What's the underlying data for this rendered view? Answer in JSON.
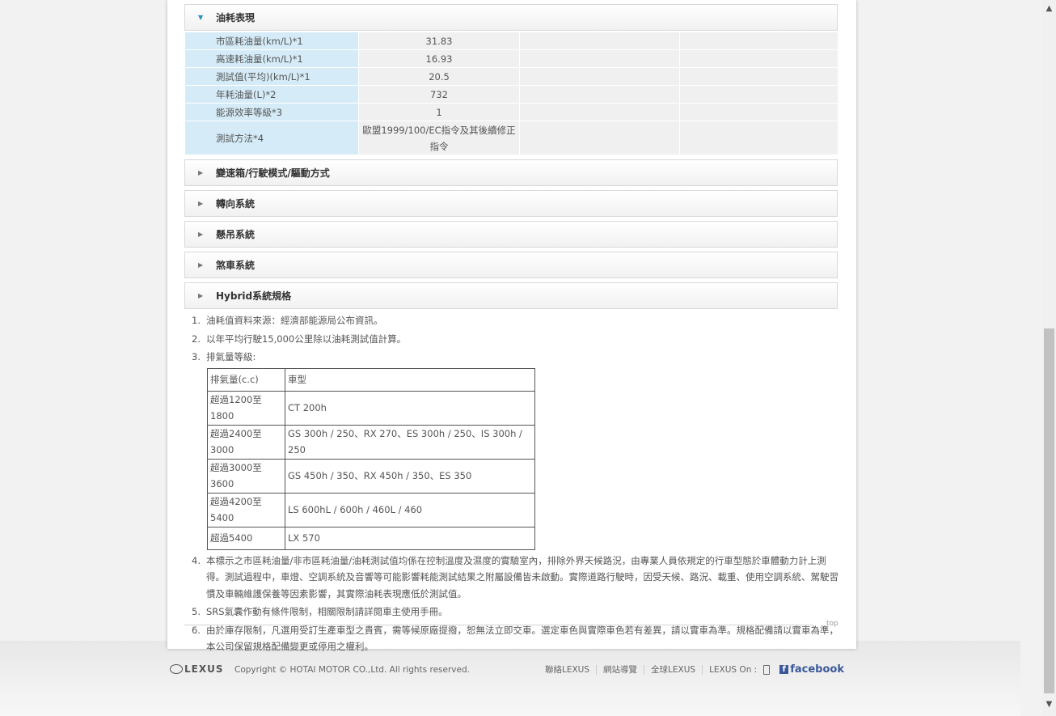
{
  "sections": {
    "fuel": "油耗表現",
    "transmission": "變速箱/行駛模式/驅動方式",
    "steering": "轉向系統",
    "suspension": "懸吊系統",
    "brake": "煞車系統",
    "hybrid": "Hybrid系統規格"
  },
  "fuel_table": [
    {
      "label": "市區耗油量(km/L)*1",
      "value": "31.83"
    },
    {
      "label": "高速耗油量(km/L)*1",
      "value": "16.93"
    },
    {
      "label": "測試值(平均)(km/L)*1",
      "value": "20.5"
    },
    {
      "label": "年耗油量(L)*2",
      "value": "732"
    },
    {
      "label": "能源效率等級*3",
      "value": "1"
    },
    {
      "label": "測試方法*4",
      "value": "歐盟1999/100/EC指令及其後續修正指令"
    }
  ],
  "notes": {
    "n1": "油耗值資料來源：經濟部能源局公布資訊。",
    "n2": "以年平均行駛15,000公里除以油耗測試值計算。",
    "n3": "排氣量等級:",
    "n4": "本標示之市區耗油量/非市區耗油量/油耗測試值均係在控制溫度及濕度的實驗室內，排除外界天候路況，由專業人員依規定的行車型態於車體動力計上測得。測試過程中，車燈、空調系統及音響等可能影響耗能測試結果之附屬設備皆未啟動。實際道路行駛時，因受天候、路況、載重、使用空調系統、駕駛習慣及車輛維護保養等因素影響，其實際油耗表現應低於測試值。",
    "n5": "SRS氣囊作動有條件限制，相關限制請詳閱車主使用手冊。",
    "n6": "由於庫存限制，凡選用受訂生產車型之貴賓，需等候原廠提撥，恕無法立即交車。選定車色與實際車色若有差異，請以實車為準。規格配備請以實車為準，本公司保留規格配備變更或停用之權利。"
  },
  "cc_table": {
    "header": [
      "排氣量(c.c)",
      "車型"
    ],
    "rows": [
      [
        "超過1200至1800",
        "CT 200h"
      ],
      [
        "超過2400至3000",
        "GS 300h / 250、RX 270、ES 300h / 250、IS 300h / 250"
      ],
      [
        "超過3000至3600",
        "GS 450h / 350、RX 450h / 350、ES 350"
      ],
      [
        "超過4200至5400",
        "LS 600hL / 600h / 460L / 460"
      ],
      [
        "超過5400",
        "LX 570"
      ]
    ]
  },
  "top_link": "top",
  "footer": {
    "logo": "LEXUS",
    "copyright": "Copyright © HOTAI MOTOR CO.,Ltd. All rights reserved.",
    "links": [
      "聯絡LEXUS",
      "網站導覽",
      "全球LEXUS"
    ],
    "lexus_on": "LEXUS On :",
    "facebook": "facebook"
  },
  "icons": {
    "expanded": "triangle-down-icon",
    "collapsed": "triangle-right-icon"
  }
}
